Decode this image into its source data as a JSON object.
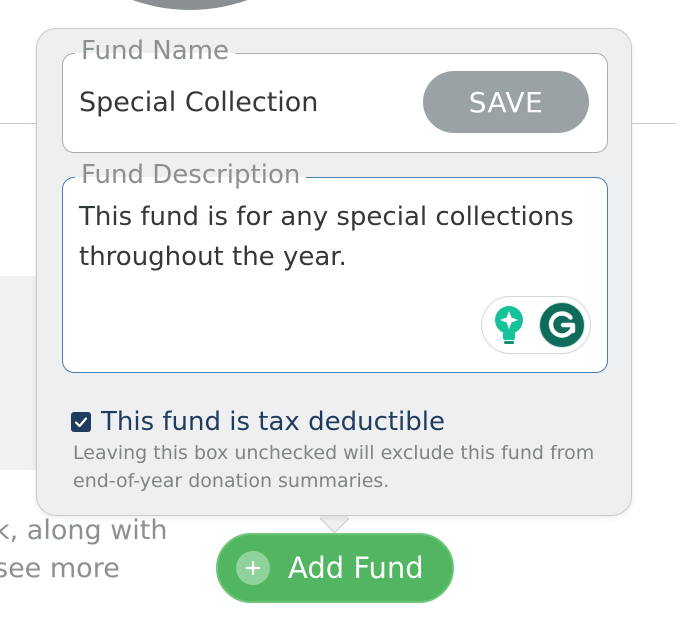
{
  "background": {
    "text_line_1": "k, along with",
    "text_line_2": "see more"
  },
  "popover": {
    "fund_name": {
      "label": "Fund Name",
      "value": "Special Collection",
      "save_label": "SAVE"
    },
    "fund_description": {
      "label": "Fund Description",
      "value": "This fund is for any special collections throughout the year."
    },
    "tax_deductible": {
      "checked": true,
      "label": "This fund is tax deductible",
      "help": "Leaving this box unchecked will exclude this fund from end-of-year donation summaries."
    },
    "grammarly": {
      "icons": [
        "lightbulb-icon",
        "grammarly-icon"
      ]
    }
  },
  "add_fund": {
    "label": "Add Fund",
    "icon": "plus-icon"
  },
  "colors": {
    "save_button": "#9aa2a5",
    "add_button": "#52b561",
    "checkbox": "#1f3b5e",
    "focus_border": "#4a7fb0",
    "grammarly_green": "#15c39a"
  }
}
